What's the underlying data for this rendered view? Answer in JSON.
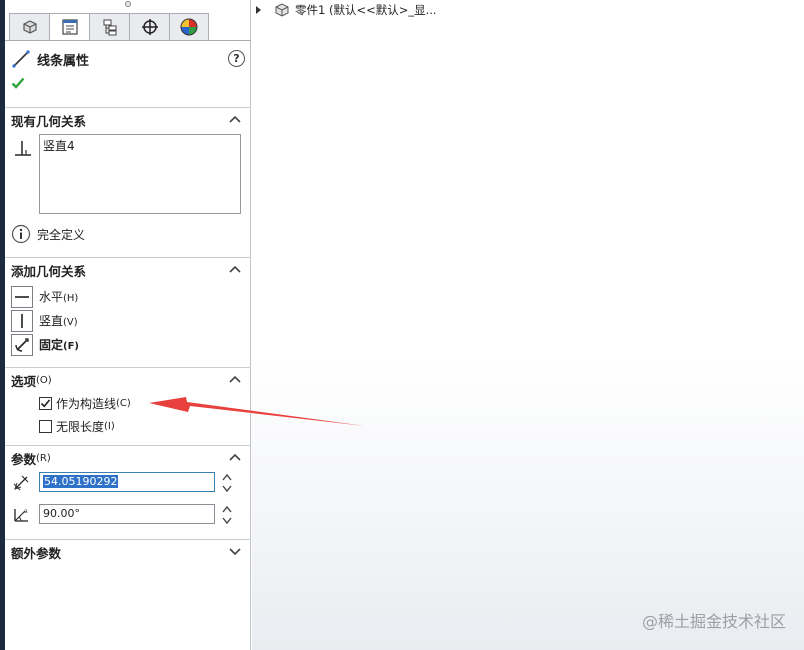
{
  "panel": {
    "title": "线条属性",
    "help_glyph": "?",
    "tabs": [
      "feature-manager-icon",
      "property-manager-icon",
      "configuration-manager-icon",
      "dimxpert-icon",
      "appearance-icon"
    ],
    "existing_relations": {
      "header": "现有几何关系",
      "items": [
        "竖直4"
      ],
      "status": "完全定义"
    },
    "add_relations": {
      "header": "添加几何关系",
      "items": [
        {
          "label": "水平",
          "shortcut": "(H)"
        },
        {
          "label": "竖直",
          "shortcut": "(V)"
        },
        {
          "label": "固定",
          "shortcut": "(F)"
        }
      ]
    },
    "options": {
      "header": "选项",
      "header_shortcut": "(O)",
      "items": [
        {
          "label": "作为构造线",
          "shortcut": "(C)",
          "checked": true
        },
        {
          "label": "无限长度",
          "shortcut": "(I)",
          "checked": false
        }
      ]
    },
    "parameters": {
      "header": "参数",
      "header_shortcut": "(R)",
      "length_value": "54.05190292",
      "angle_value": "90.00°"
    },
    "extra": {
      "header": "额外参数"
    }
  },
  "viewport": {
    "tree_item": "零件1  (默认<<默认>_显...",
    "watermark": "@稀土掘金技术社区"
  },
  "colors": {
    "accent": "#2e71c9",
    "annotation_arrow": "#e8403c",
    "check_green": "#2fa33a"
  }
}
